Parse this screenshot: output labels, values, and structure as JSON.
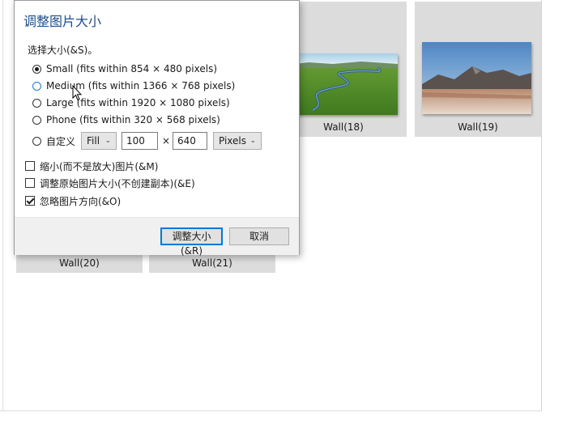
{
  "dialog": {
    "title": "调整图片大小",
    "size_label": "选择大小(&S)。",
    "options": [
      {
        "label": "Small (fits within 854 × 480 pixels)",
        "checked": true
      },
      {
        "label": "Medium (fits within 1366 × 768 pixels)",
        "checked": false
      },
      {
        "label": "Large (fits within 1920 × 1080 pixels)",
        "checked": false
      },
      {
        "label": "Phone (fits within 320 × 568 pixels)",
        "checked": false
      }
    ],
    "custom": {
      "label": "自定义",
      "fit_mode": "Fill",
      "width": "100",
      "times": "×",
      "height": "640",
      "unit": "Pixels"
    },
    "checkboxes": [
      {
        "label": "缩小(而不是放大)图片(&M)",
        "checked": false
      },
      {
        "label": "调整原始图片大小(不创建副本)(&E)",
        "checked": false
      },
      {
        "label": "忽略图片方向(&O)",
        "checked": true
      }
    ],
    "resize_button": "调整大小(&R)",
    "cancel_button": "取消"
  },
  "gallery": {
    "tiles": [
      {
        "caption": "Wall(18)"
      },
      {
        "caption": "Wall(19)"
      },
      {
        "caption": "Wall(20)"
      },
      {
        "caption": "Wall(21)"
      }
    ]
  },
  "icons": {
    "chevron": "chevron-down-icon",
    "cursor": "mouse-pointer-icon"
  }
}
